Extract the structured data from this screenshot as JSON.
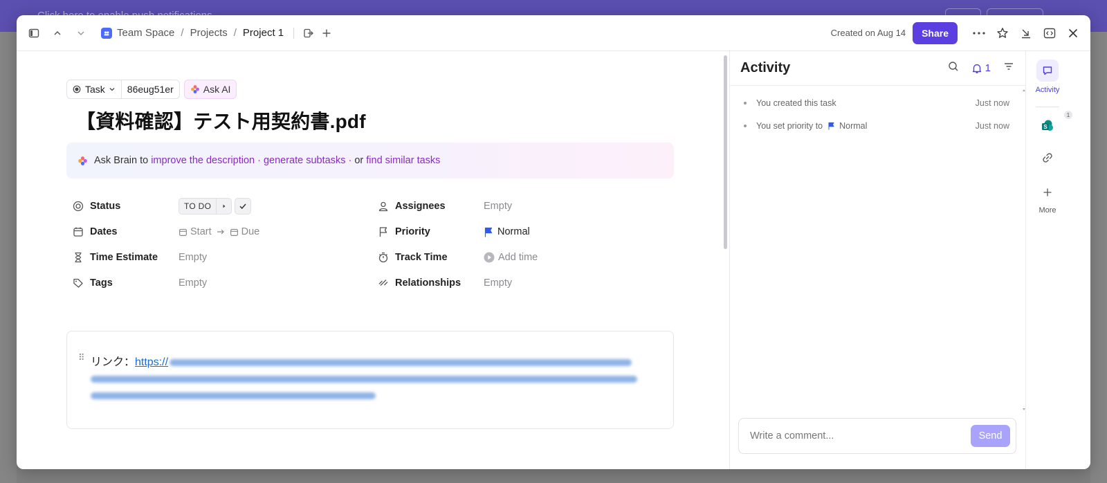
{
  "background": {
    "notice": "Click here to enable push notifications"
  },
  "topbar": {
    "breadcrumb": {
      "space": "Team Space",
      "folder": "Projects",
      "list": "Project 1",
      "sep": "/"
    },
    "created": "Created on Aug 14",
    "share_label": "Share",
    "icons": [
      "sidebar-toggle-icon",
      "chevron-up-icon",
      "chevron-down-icon",
      "move-icon",
      "plus-icon",
      "more-icon",
      "star-icon",
      "minimize-icon",
      "expand-icon",
      "close-icon"
    ]
  },
  "task": {
    "type_label": "Task",
    "id": "86eug51er",
    "ask_ai_label": "Ask AI",
    "title": "【資料確認】テスト用契約書.pdf"
  },
  "brain": {
    "prefix": "Ask Brain to",
    "link1": "improve the description",
    "link2": "generate subtasks",
    "or_text": "or",
    "link3": "find similar tasks",
    "dot": "·"
  },
  "fields": {
    "status": {
      "label": "Status",
      "value": "TO DO"
    },
    "dates": {
      "label": "Dates",
      "start": "Start",
      "due": "Due"
    },
    "time_estimate": {
      "label": "Time Estimate",
      "value": "Empty"
    },
    "tags": {
      "label": "Tags",
      "value": "Empty"
    },
    "assignees": {
      "label": "Assignees",
      "value": "Empty"
    },
    "priority": {
      "label": "Priority",
      "value": "Normal",
      "color": "#2f5bea"
    },
    "track_time": {
      "label": "Track Time",
      "value": "Add time"
    },
    "relationships": {
      "label": "Relationships",
      "value": "Empty"
    }
  },
  "description": {
    "prefix": "リンク：",
    "url_visible": "https://"
  },
  "activity": {
    "title": "Activity",
    "notification_count": "1",
    "items": [
      {
        "text": "You created this task",
        "when": "Just now"
      },
      {
        "text": "You set priority to",
        "value": "Normal",
        "when": "Just now"
      }
    ],
    "comment_placeholder": "Write a comment...",
    "send_label": "Send"
  },
  "rail": {
    "activity_label": "Activity",
    "sharepoint_badge": "1",
    "more_label": "More"
  },
  "colors": {
    "accent": "#5b3fe0",
    "brain_link": "#8b28c9",
    "priority_flag": "#2f5bea",
    "send_disabled": "#a9a3fb"
  }
}
